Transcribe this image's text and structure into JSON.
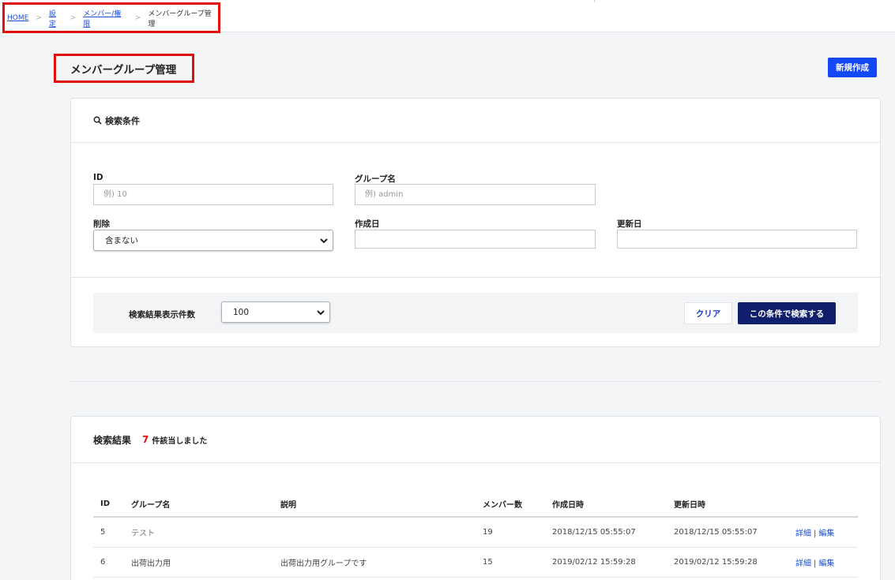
{
  "breadcrumb": {
    "items": [
      "HOME",
      "設定",
      "メンバー/権限"
    ],
    "separator": ">",
    "current": "メンバーグループ管理"
  },
  "page": {
    "title": "メンバーグループ管理",
    "new_button": "新規作成"
  },
  "search": {
    "heading": "検索条件",
    "id_label": "ID",
    "id_placeholder": "例) 10",
    "group_label": "グループ名",
    "group_placeholder": "例) admin",
    "delete_label": "削除",
    "delete_value": "含まない",
    "created_label": "作成日",
    "updated_label": "更新日",
    "display_count_label": "検索結果表示件数",
    "display_count_value": "100",
    "clear_button": "クリア",
    "search_button": "この条件で検索する"
  },
  "results": {
    "heading": "検索結果",
    "count": "7",
    "count_suffix": "件該当しました",
    "columns": [
      "ID",
      "グループ名",
      "説明",
      "メンバー数",
      "作成日時",
      "更新日時"
    ],
    "rows": [
      {
        "id": "5",
        "name": "テスト",
        "desc": "",
        "members": "19",
        "created": "2018/12/15 05:55:07",
        "updated": "2018/12/15 05:55:07",
        "detail": "詳細",
        "divider": "|",
        "edit": "編集"
      },
      {
        "id": "6",
        "name": "出荷出力用",
        "desc": "出荷出力用グループです",
        "members": "15",
        "created": "2019/02/12 15:59:28",
        "updated": "2019/02/12 15:59:28",
        "detail": "詳細",
        "divider": "|",
        "edit": "編集"
      }
    ]
  },
  "colors": {
    "primary": "#1447f5",
    "dark_button": "#101f6b",
    "highlight": "#e01010",
    "link": "#1a4fd8"
  },
  "icons": [
    "search-icon",
    "chevron-down-icon"
  ]
}
